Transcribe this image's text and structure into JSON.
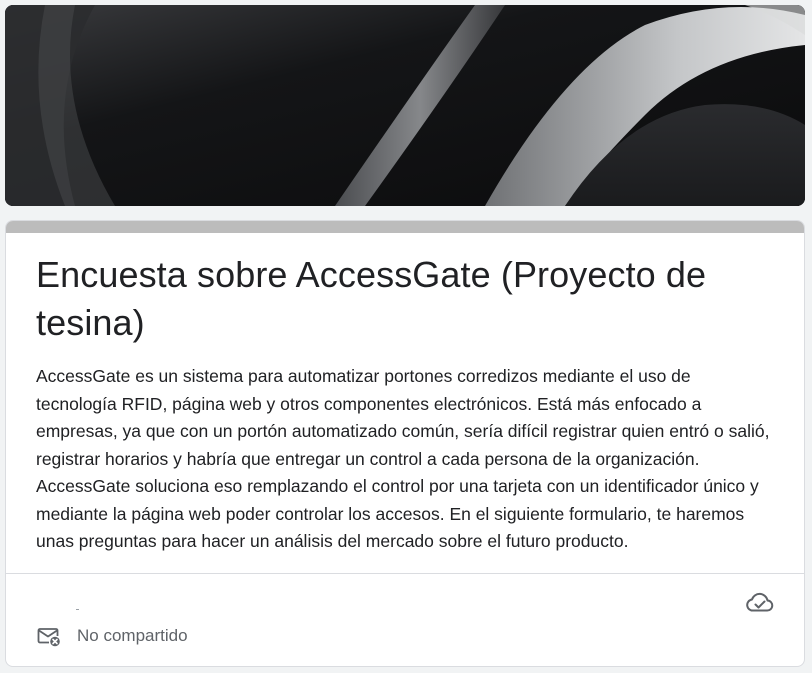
{
  "form": {
    "title": "Encuesta sobre AccessGate (Proyecto de tesina)",
    "description": "AccessGate es un sistema para automatizar portones corredizos mediante el uso de tecnología RFID, página web y otros componentes electrónicos. Está más enfocado a empresas, ya que con un portón automatizado común, sería difícil registrar quien entró o salió, registrar horarios y habría que entregar un control a cada persona de la organización. AccessGate soluciona eso remplazando el control por una tarjeta con un identificador único y mediante la página web poder controlar los accesos. En el siguiente formulario, te haremos unas preguntas para hacer un análisis del mercado sobre el futuro producto."
  },
  "footer": {
    "share_status": "No compartido",
    "share_icon": "mail-x-icon",
    "save_icon": "cloud-check-icon"
  },
  "colors": {
    "accent_bar": "#bcbcbc",
    "text_primary": "#202124",
    "text_secondary": "#5f6368"
  }
}
